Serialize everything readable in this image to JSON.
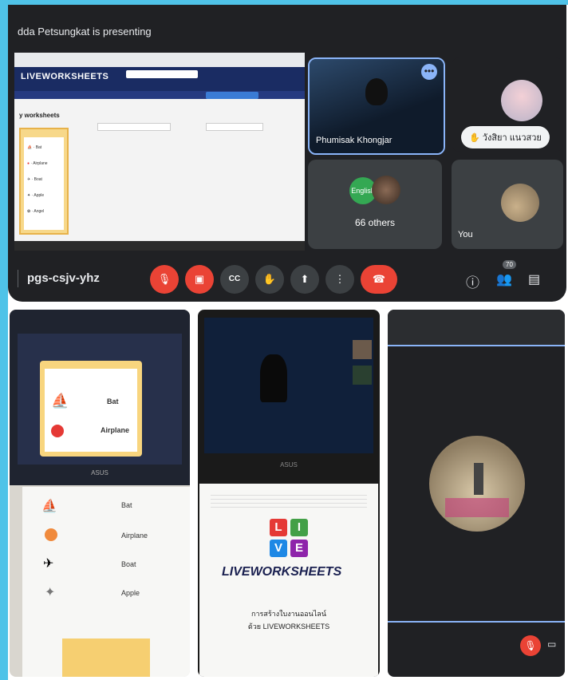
{
  "meet": {
    "presenter_text": "dda Petsungkat is presenting",
    "meeting_code": "pgs-csjv-yhz",
    "participant_count": "70",
    "active_speaker_name": "Phumisak Khongjar",
    "participant_chip_name": "วังสิยา แนวสวย",
    "others_label": "66 others",
    "others_overlay": "English",
    "self_label": "You",
    "more_dots": "•••"
  },
  "shared_screen": {
    "logo": "LIVEWORKSHEETS",
    "page_title": "y worksheets",
    "worksheet_words": [
      "Bat",
      "Airplane",
      "Boat",
      "Apple",
      "Angel"
    ]
  },
  "photo1": {
    "screen_words": [
      "Bat",
      "Airplane"
    ],
    "paper_words": [
      "Bat",
      "Airplane",
      "Boat",
      "Apple"
    ],
    "brand": "ASUS"
  },
  "photo2": {
    "logo_letters": [
      "L",
      "I",
      "V",
      "E"
    ],
    "logo_word": "LIVEWORKSHEETS",
    "caption_line1": "การสร้างใบงานออนไลน์",
    "caption_line2": "ด้วย LIVEWORKSHEETS",
    "brand": "ASUS"
  },
  "colors": {
    "stripe": "#4fc3e8",
    "meet_bg": "#202124",
    "tile_bg": "#3c4043",
    "accent_blue": "#8ab4f8",
    "danger": "#ea4335",
    "lv_red": "#e53935",
    "lv_green": "#43a047",
    "lv_blue": "#1e88e5",
    "lv_purple": "#8e24aa"
  },
  "icons": {
    "mic_off": "mic-off-icon",
    "cam_off": "camera-off-icon",
    "captions": "captions-icon",
    "hand": "raise-hand-icon",
    "present": "present-icon",
    "more": "more-vertical-icon",
    "hangup": "hang-up-icon",
    "info": "info-icon",
    "people": "people-icon",
    "chat": "chat-icon"
  }
}
